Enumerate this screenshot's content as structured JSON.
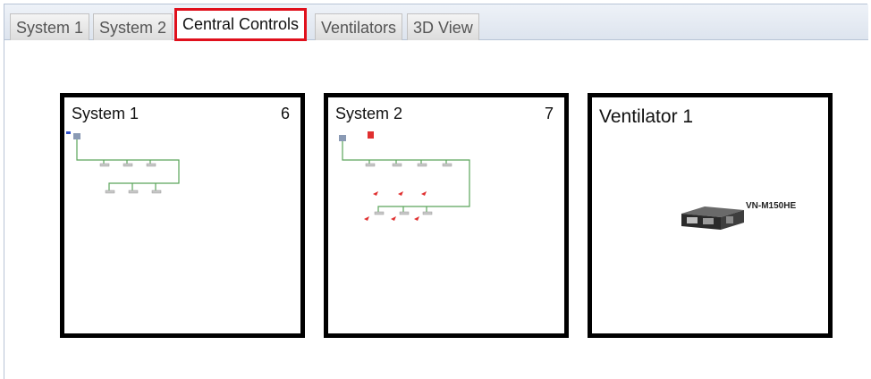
{
  "tabs": [
    {
      "label": "System 1",
      "active": false
    },
    {
      "label": "System 2",
      "active": false
    },
    {
      "label": "Central Controls",
      "active": true
    },
    {
      "label": "Ventilators",
      "active": false
    },
    {
      "label": "3D View",
      "active": false
    }
  ],
  "panels": [
    {
      "title": "System 1",
      "count": "6"
    },
    {
      "title": "System 2",
      "count": "7"
    },
    {
      "title": "Ventilator 1",
      "model": "VN-M150HE"
    }
  ],
  "colors": {
    "highlight": "#e0101c",
    "pipe": "#5aa55a",
    "unit_red": "#e03030"
  }
}
